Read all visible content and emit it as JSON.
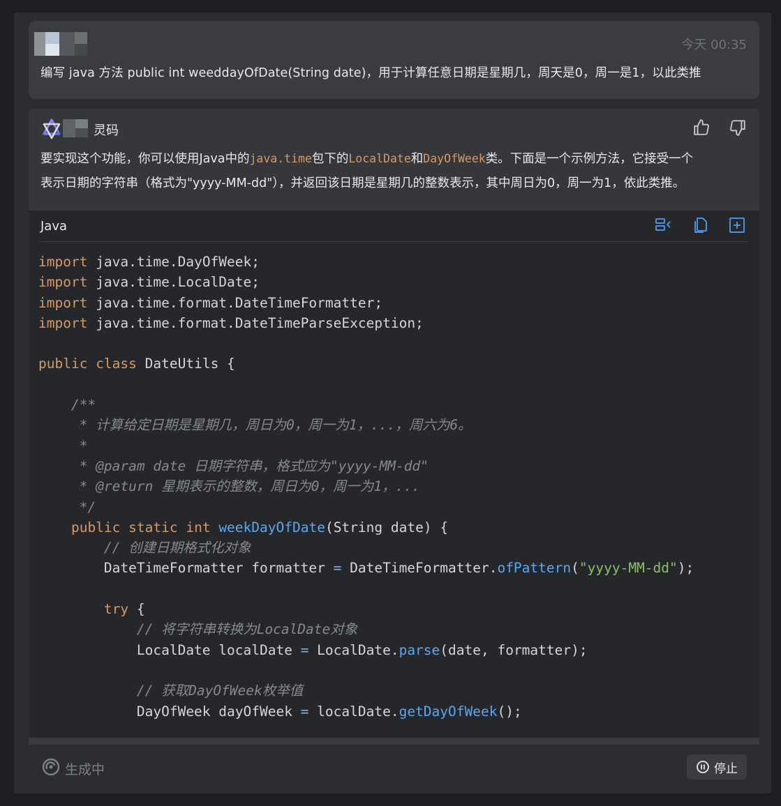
{
  "user_message": {
    "timestamp": "今天 00:35",
    "text": "编写 java 方法 public int weeddayOfDate(String date)，用于计算任意日期是星期几，周天是0，周一是1，以此类推"
  },
  "assistant": {
    "name": "灵码",
    "reply": {
      "p1": "要实现这个功能，你可以使用Java中的",
      "c1": "java.time",
      "p2": "包下的",
      "c2": "LocalDate",
      "p3": "和",
      "c3": "DayOfWeek",
      "p4": "类。下面是一个示例方法，它接受一个",
      "line2": "表示日期的字符串（格式为\"yyyy-MM-dd\"），并返回该日期是星期几的整数表示，其中周日为0，周一为1，依此类推。"
    },
    "icons": {
      "like": "thumbs-up-icon",
      "dislike": "thumbs-down-icon"
    }
  },
  "code_block": {
    "language": "Java",
    "icons": [
      "insert-diff-icon",
      "copy-icon",
      "insert-new-file-icon"
    ],
    "t": {
      "import": "import",
      "imp1": " java.time.DayOfWeek;",
      "imp2": " java.time.LocalDate;",
      "imp3": " java.time.format.DateTimeFormatter;",
      "imp4": " java.time.format.DateTimeParseException;",
      "public": "public",
      "class": " class",
      "classname": " DateUtils {",
      "doc_open": "    /**",
      "doc1": "     * 计算给定日期是星期几，周日为0，周一为1，...，周六为6。",
      "doc2": "     *",
      "doc3": "     * @param date 日期字符串，格式应为\"yyyy-MM-dd\"",
      "doc4": "     * @return 星期表示的整数，周日为0，周一为1，...",
      "doc_close": "     */",
      "indent4": "    ",
      "static": " static",
      "int": " int",
      "method": " weekDayOfDate",
      "sig_rest": "(String date) {",
      "c_fmt": "        // 创建日期格式化对象",
      "fmt_a": "        DateTimeFormatter formatter ",
      "eq": "=",
      "fmt_b": " DateTimeFormatter.",
      "ofPattern": "ofPattern",
      "paren_open": "(",
      "pattern": "\"yyyy-MM-dd\"",
      "end_stmt": ");",
      "indent8": "        ",
      "try": "try",
      "brace": " {",
      "c_parse": "            // 将字符串转换为LocalDate对象",
      "ld_a": "            LocalDate localDate ",
      "ld_b": " LocalDate.",
      "parse": "parse",
      "parse_args": "(date, formatter);",
      "c_dow": "            // 获取DayOfWeek枚举值",
      "dow_a": "            DayOfWeek dayOfWeek ",
      "dow_b": " localDate.",
      "getDayOfWeek": "getDayOfWeek",
      "call_end": "();"
    }
  },
  "status_bar": {
    "generating": "生成中",
    "stop_label": "停止"
  },
  "colors": {
    "background": "#2b2d30",
    "card": "#3a3c40",
    "code_bg": "#25272a",
    "keyword": "#d49a6a",
    "function": "#5aa7f5",
    "string": "#8cbf6b",
    "comment": "#86898e",
    "icon_accent": "#4a90e2"
  }
}
